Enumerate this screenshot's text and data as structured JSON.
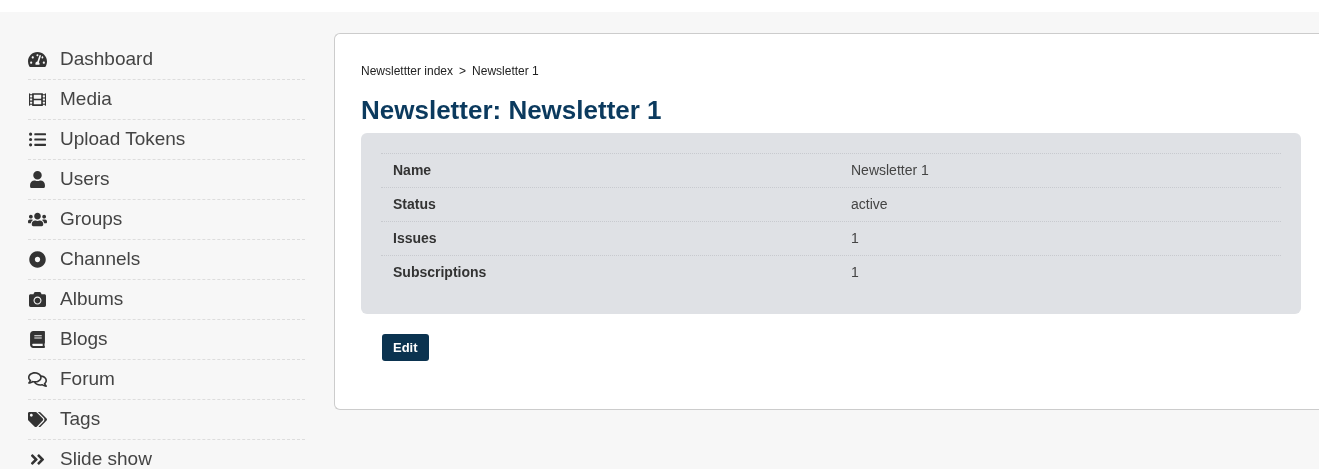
{
  "sidebar": {
    "items": [
      {
        "label": "Dashboard"
      },
      {
        "label": "Media"
      },
      {
        "label": "Upload Tokens"
      },
      {
        "label": "Users"
      },
      {
        "label": "Groups"
      },
      {
        "label": "Channels"
      },
      {
        "label": "Albums"
      },
      {
        "label": "Blogs"
      },
      {
        "label": "Forum"
      },
      {
        "label": "Tags"
      },
      {
        "label": "Slide show"
      }
    ]
  },
  "breadcrumb": [
    {
      "label": "Newslettter index"
    },
    {
      "label": "Newsletter 1"
    }
  ],
  "breadcrumb_separator": ">",
  "title": "Newsletter: Newsletter 1",
  "details": [
    {
      "label": "Name",
      "value": "Newsletter 1"
    },
    {
      "label": "Status",
      "value": "active"
    },
    {
      "label": "Issues",
      "value": "1"
    },
    {
      "label": "Subscriptions",
      "value": "1"
    }
  ],
  "buttons": [
    "Edit"
  ]
}
